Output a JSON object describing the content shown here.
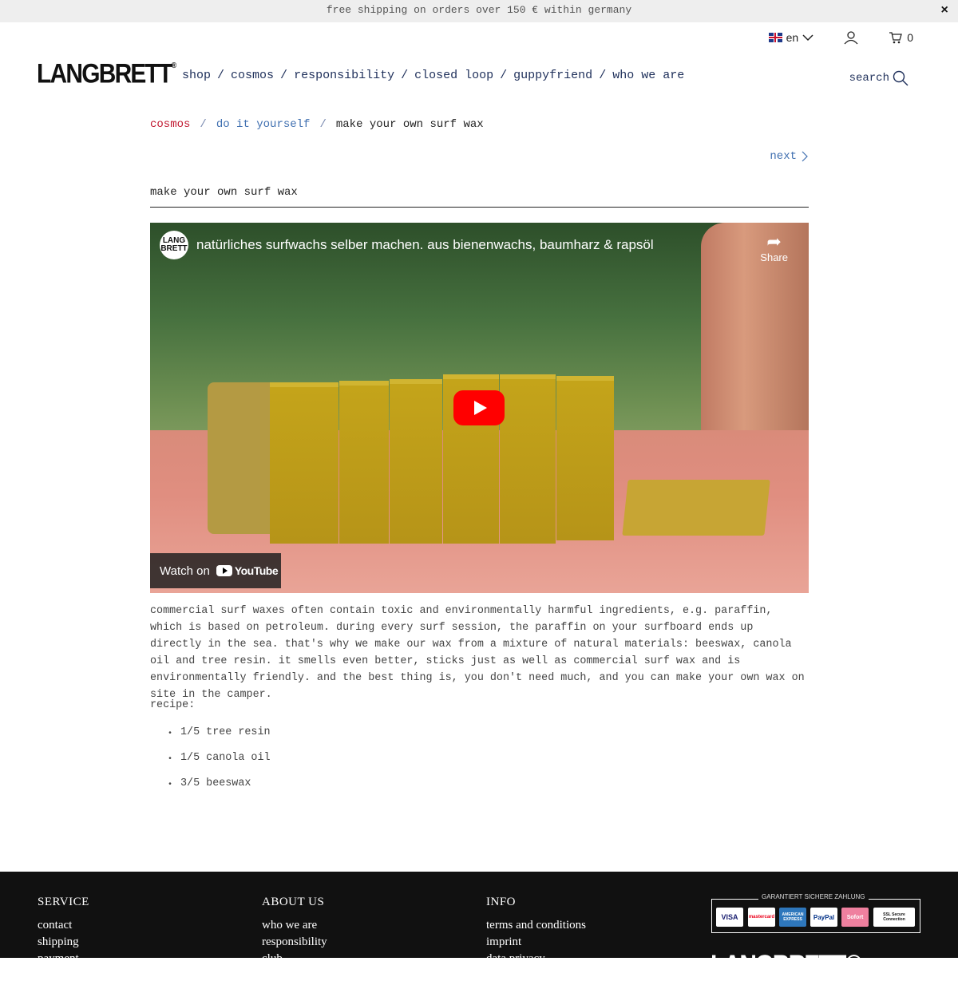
{
  "announcement": {
    "text": "free shipping on orders over 150 € within germany",
    "close": "×"
  },
  "header": {
    "logo": "LANGBRETT",
    "logo_mark": "®",
    "language": "en",
    "cart_count": "0",
    "search_label": "search",
    "nav": [
      "shop",
      "cosmos",
      "responsibility",
      "closed loop",
      "guppyfriend",
      "who we are"
    ],
    "nav_sep": "/"
  },
  "breadcrumb": {
    "items": [
      "cosmos",
      "do it yourself",
      "make your own surf wax"
    ],
    "sep": "/"
  },
  "pager": {
    "next": "next"
  },
  "article": {
    "title": "make your own surf wax",
    "video": {
      "title": "natürliches surfwachs selber machen. aus bienenwachs, baumharz & rapsöl",
      "channel_logo": "LANG BRETT",
      "share": "Share",
      "watch_on": "Watch on",
      "youtube": "YouTube"
    },
    "body": "commercial surf waxes often contain toxic and environmentally harmful ingredients, e.g. paraffin, which is based on petroleum. during every surf session, the paraffin on your surfboard ends up directly in the sea. that's why we make our wax from a mixture of natural materials: beeswax, canola oil and tree resin. it smells even better, sticks just as well as commercial surf wax and is environmentally friendly. and the best thing is, you don't need much, and you can make your own wax on site in the camper.",
    "recipe_label": "recipe:",
    "recipe": [
      "1/5 tree resin",
      "1/5 canola oil",
      "3/5 beeswax"
    ]
  },
  "footer": {
    "service": {
      "title": "SERVICE",
      "links": [
        "contact",
        "shipping",
        "payment"
      ]
    },
    "about": {
      "title": "ABOUT US",
      "links": [
        "who we are",
        "responsibility",
        "club"
      ]
    },
    "info": {
      "title": "INFO",
      "links": [
        "terms and conditions",
        "imprint",
        "data privacy"
      ]
    },
    "payment_title": "GARANTIERT SICHERE ZAHLUNG",
    "payment_methods": [
      "VISA",
      "mastercard",
      "AMERICAN EXPRESS",
      "PayPal",
      "Sofort",
      "SSL Secure Connection"
    ],
    "logo": "LANGBRETT®"
  },
  "colors": {
    "accent_red": "#c0172f",
    "link_blue": "#3f6fb0",
    "nav_navy": "#1e2f5a",
    "footer_bg": "#111111"
  }
}
